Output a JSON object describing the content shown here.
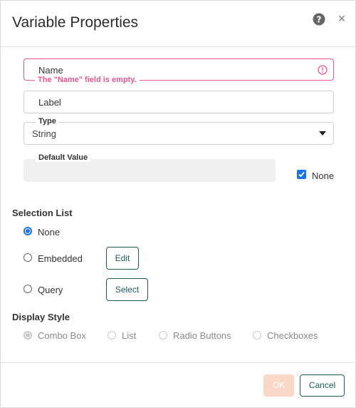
{
  "dialog": {
    "title": "Variable Properties",
    "help_icon": "help-icon",
    "close_label": "×"
  },
  "fields": {
    "name": {
      "label": "Name",
      "error": "The \"Name\" field is empty."
    },
    "label": {
      "label": "Label"
    },
    "type": {
      "legend": "Type",
      "value": "String"
    },
    "default_value": {
      "legend": "Default Value",
      "none_label": "None",
      "none_checked": true
    }
  },
  "selection_list": {
    "title": "Selection List",
    "options": [
      {
        "label": "None",
        "checked": true
      },
      {
        "label": "Embedded",
        "checked": false,
        "button": "Edit"
      },
      {
        "label": "Query",
        "checked": false,
        "button": "Select"
      }
    ]
  },
  "display_style": {
    "title": "Display Style",
    "options": [
      {
        "label": "Combo Box",
        "checked": true,
        "disabled": true
      },
      {
        "label": "List",
        "checked": false,
        "disabled": true
      },
      {
        "label": "Radio Buttons",
        "checked": false,
        "disabled": true
      },
      {
        "label": "Checkboxes",
        "checked": false,
        "disabled": true
      }
    ]
  },
  "footer": {
    "ok_label": "OK",
    "cancel_label": "Cancel"
  },
  "colors": {
    "accent": "#1a73e8",
    "error": "#e5578d",
    "button_border": "#1f5a5a",
    "ok_disabled": "#f9d8c8"
  }
}
